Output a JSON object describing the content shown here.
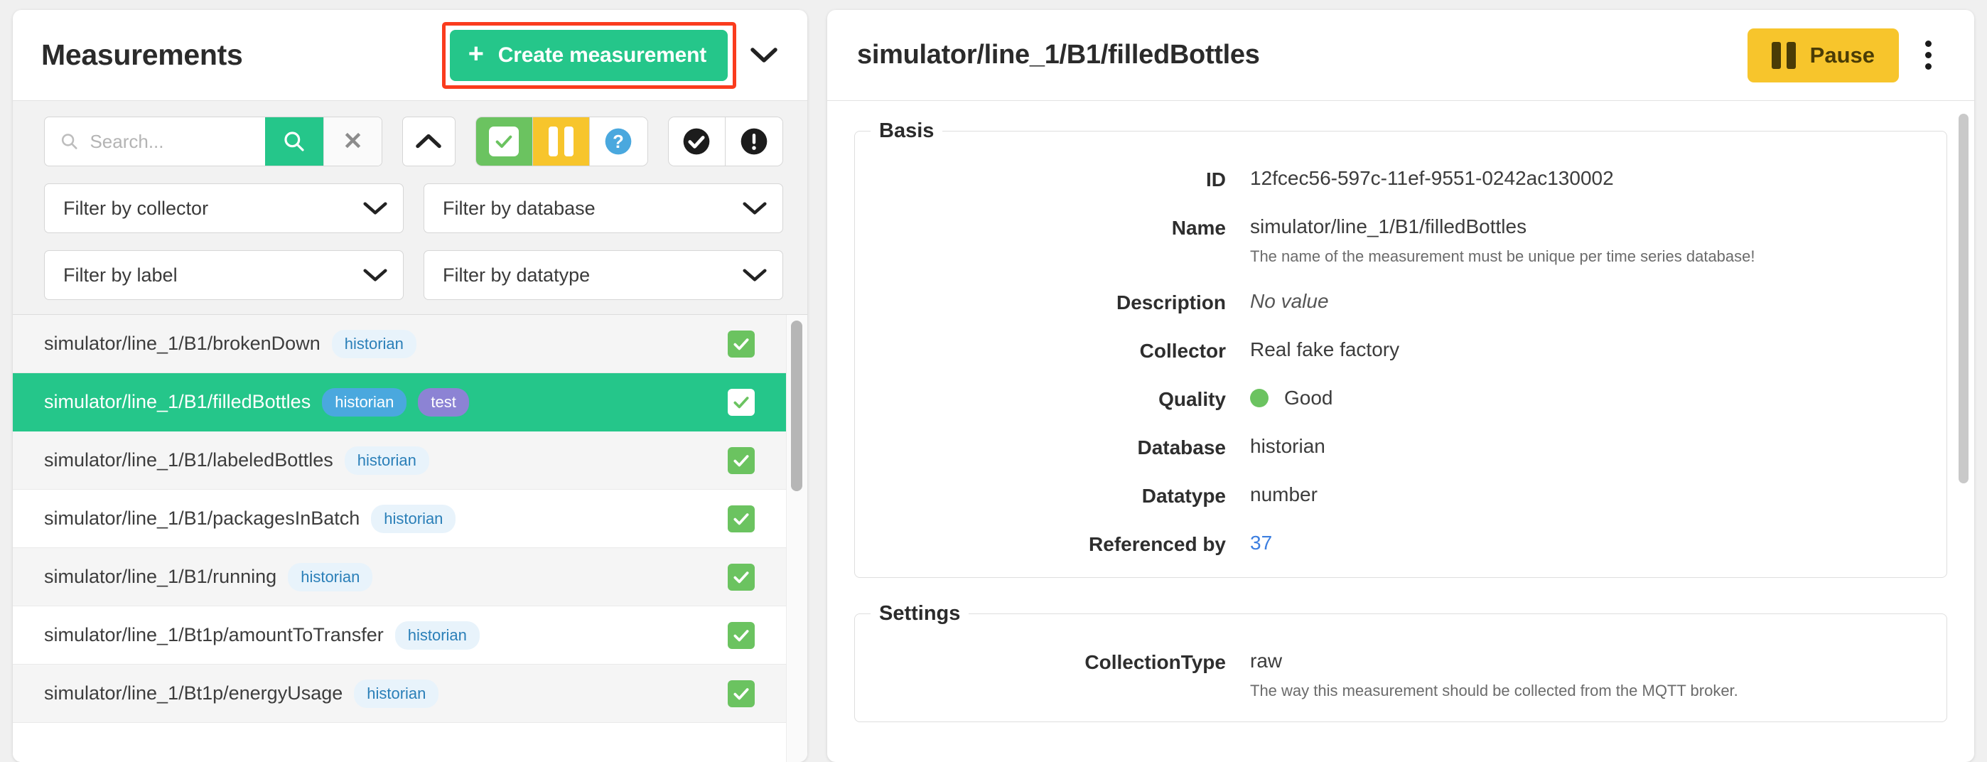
{
  "left": {
    "title": "Measurements",
    "create_button": {
      "label": "Create measurement",
      "icon": "plus-icon"
    },
    "create_dropdown_icon": "chevron-down-icon",
    "search": {
      "placeholder": "Search...",
      "value": ""
    },
    "toolbar": {
      "search_icon": "search-icon",
      "submit_icon": "search-icon",
      "clear_icon": "close-icon",
      "collapse_icon": "chevron-up-icon",
      "enabled_icon": "checkbox-checked-icon",
      "paused_icon": "pause-icon",
      "unknown_icon": "question-circle-icon",
      "ok_icon": "check-circle-icon",
      "error_icon": "exclamation-circle-icon"
    },
    "filters": [
      {
        "label": "Filter by collector",
        "icon": "chevron-down-icon"
      },
      {
        "label": "Filter by database",
        "icon": "chevron-down-icon"
      },
      {
        "label": "Filter by label",
        "icon": "chevron-down-icon"
      },
      {
        "label": "Filter by datatype",
        "icon": "chevron-down-icon"
      }
    ],
    "rows": [
      {
        "name": "simulator/line_1/B1/brokenDown",
        "badges": [
          "historian"
        ],
        "checked": true,
        "selected": false
      },
      {
        "name": "simulator/line_1/B1/filledBottles",
        "badges": [
          "historian",
          "test"
        ],
        "checked": true,
        "selected": true
      },
      {
        "name": "simulator/line_1/B1/labeledBottles",
        "badges": [
          "historian"
        ],
        "checked": true,
        "selected": false
      },
      {
        "name": "simulator/line_1/B1/packagesInBatch",
        "badges": [
          "historian"
        ],
        "checked": true,
        "selected": false
      },
      {
        "name": "simulator/line_1/B1/running",
        "badges": [
          "historian"
        ],
        "checked": true,
        "selected": false
      },
      {
        "name": "simulator/line_1/Bt1p/amountToTransfer",
        "badges": [
          "historian"
        ],
        "checked": true,
        "selected": false
      },
      {
        "name": "simulator/line_1/Bt1p/energyUsage",
        "badges": [
          "historian"
        ],
        "checked": true,
        "selected": false
      }
    ]
  },
  "right": {
    "title": "simulator/line_1/B1/filledBottles",
    "pause_button": {
      "label": "Pause",
      "icon": "pause-icon"
    },
    "menu_icon": "kebab-menu-icon",
    "basis": {
      "legend": "Basis",
      "fields": [
        {
          "label": "ID",
          "value": "12fcec56-597c-11ef-9551-0242ac130002",
          "hint": ""
        },
        {
          "label": "Name",
          "value": "simulator/line_1/B1/filledBottles",
          "hint": "The name of the measurement must be unique per time series database!"
        },
        {
          "label": "Description",
          "value": "No value",
          "hint": "",
          "style": "muted"
        },
        {
          "label": "Collector",
          "value": "Real fake factory",
          "hint": ""
        },
        {
          "label": "Quality",
          "value": "Good",
          "hint": "",
          "style": "quality"
        },
        {
          "label": "Database",
          "value": "historian",
          "hint": ""
        },
        {
          "label": "Datatype",
          "value": "number",
          "hint": ""
        },
        {
          "label": "Referenced by",
          "value": "37",
          "hint": "",
          "style": "link"
        }
      ]
    },
    "settings": {
      "legend": "Settings",
      "fields": [
        {
          "label": "CollectionType",
          "value": "raw",
          "hint": "The way this measurement should be collected from the MQTT broker."
        }
      ]
    }
  },
  "colors": {
    "accent_green": "#25c68a",
    "checkbox_green": "#6bc360",
    "warning_yellow": "#f7c52c",
    "badge_blue": "#2a7fb8",
    "badge_purple": "#8c83d4",
    "highlight_red": "#fa3c1e",
    "link_blue": "#3d7fe0"
  }
}
